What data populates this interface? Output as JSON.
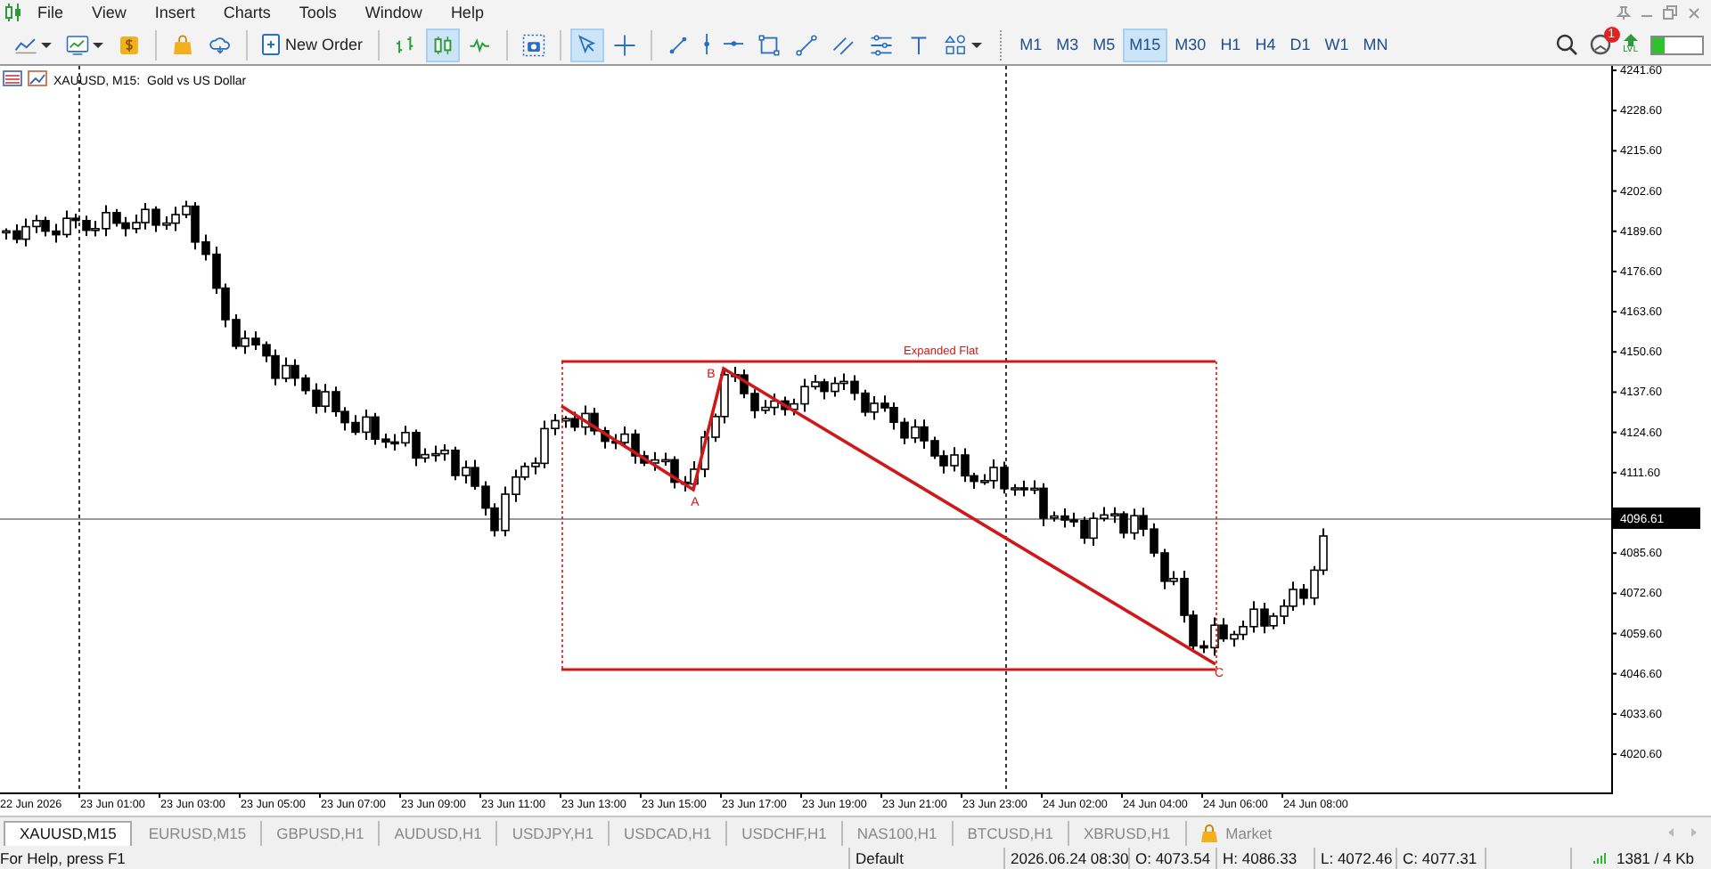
{
  "menu": [
    "File",
    "View",
    "Insert",
    "Charts",
    "Tools",
    "Window",
    "Help"
  ],
  "toolbar": {
    "groups": [
      [
        {
          "kind": "line-chart-menu",
          "selected": false
        },
        {
          "kind": "indicators-menu",
          "selected": false
        },
        {
          "kind": "dollar",
          "selected": false
        }
      ],
      [
        {
          "kind": "bag",
          "selected": false
        },
        {
          "kind": "cloud",
          "selected": false
        }
      ],
      [
        {
          "kind": "new-order",
          "label": "New Order",
          "selected": false
        }
      ],
      [
        {
          "kind": "bar-chart",
          "selected": false
        },
        {
          "kind": "candle-chart",
          "selected": true
        },
        {
          "kind": "line-chart",
          "selected": false
        }
      ],
      [
        {
          "kind": "screenshot",
          "selected": false
        }
      ],
      [
        {
          "kind": "cursor",
          "selected": true
        },
        {
          "kind": "crosshair",
          "selected": false
        }
      ],
      [
        {
          "kind": "trendline",
          "selected": false
        },
        {
          "kind": "vline",
          "selected": false
        },
        {
          "kind": "hline",
          "selected": false
        },
        {
          "kind": "rectangle",
          "selected": false
        },
        {
          "kind": "line",
          "selected": false
        },
        {
          "kind": "channel",
          "selected": false
        },
        {
          "kind": "fibo",
          "selected": false
        },
        {
          "kind": "text",
          "selected": false
        },
        {
          "kind": "shapes-menu",
          "selected": false
        }
      ]
    ],
    "timeframes": [
      {
        "label": "M1",
        "selected": false
      },
      {
        "label": "M3",
        "selected": false
      },
      {
        "label": "M5",
        "selected": false
      },
      {
        "label": "M15",
        "selected": true
      },
      {
        "label": "M30",
        "selected": false
      },
      {
        "label": "H1",
        "selected": false
      },
      {
        "label": "H4",
        "selected": false
      },
      {
        "label": "D1",
        "selected": false
      },
      {
        "label": "W1",
        "selected": false
      },
      {
        "label": "MN",
        "selected": false
      }
    ],
    "notification_badge": "1",
    "signal_label": "LVL",
    "connection": {
      "level": 0.25
    }
  },
  "chart": {
    "title": "XAUUSD, M15:  Gold vs US Dollar",
    "current_price": "4096.61",
    "price_axis": [
      "4241.60",
      "4228.60",
      "4215.60",
      "4202.60",
      "4189.60",
      "4176.60",
      "4163.60",
      "4150.60",
      "4137.60",
      "4124.60",
      "4111.60",
      "4085.60",
      "4072.60",
      "4059.60",
      "4046.60",
      "4033.60",
      "4020.60"
    ],
    "time_axis": [
      "22 Jun 2026",
      "23 Jun 01:00",
      "23 Jun 03:00",
      "23 Jun 05:00",
      "23 Jun 07:00",
      "23 Jun 09:00",
      "23 Jun 11:00",
      "23 Jun 13:00",
      "23 Jun 15:00",
      "23 Jun 17:00",
      "23 Jun 19:00",
      "23 Jun 21:00",
      "23 Jun 23:00",
      "24 Jun 02:00",
      "24 Jun 04:00",
      "24 Jun 06:00",
      "24 Jun 08:00"
    ],
    "pattern": {
      "title": "Expanded Flat",
      "points": [
        "A",
        "B",
        "C"
      ]
    }
  },
  "tabs": [
    {
      "label": "XAUUSD,M15",
      "kind": "chart",
      "selected": true
    },
    {
      "label": "EURUSD,M15",
      "kind": "chart",
      "selected": false
    },
    {
      "label": "GBPUSD,H1",
      "kind": "chart",
      "selected": false
    },
    {
      "label": "AUDUSD,H1",
      "kind": "chart",
      "selected": false
    },
    {
      "label": "USDJPY,H1",
      "kind": "chart",
      "selected": false
    },
    {
      "label": "USDCAD,H1",
      "kind": "chart",
      "selected": false
    },
    {
      "label": "USDCHF,H1",
      "kind": "chart",
      "selected": false
    },
    {
      "label": "NAS100,H1",
      "kind": "chart",
      "selected": false
    },
    {
      "label": "BTCUSD,H1",
      "kind": "chart",
      "selected": false
    },
    {
      "label": "XBRUSD,H1",
      "kind": "chart",
      "selected": false
    },
    {
      "label": "Market",
      "kind": "market",
      "selected": false
    }
  ],
  "status_bar": {
    "help": "For Help, press F1",
    "profile": "Default",
    "time": "2026.06.24 08:30",
    "open": "O: 4073.54",
    "high": "H: 4086.33",
    "low": "L: 4072.46",
    "close": "C: 4077.31",
    "traffic": "1381 / 4 Kb"
  }
}
